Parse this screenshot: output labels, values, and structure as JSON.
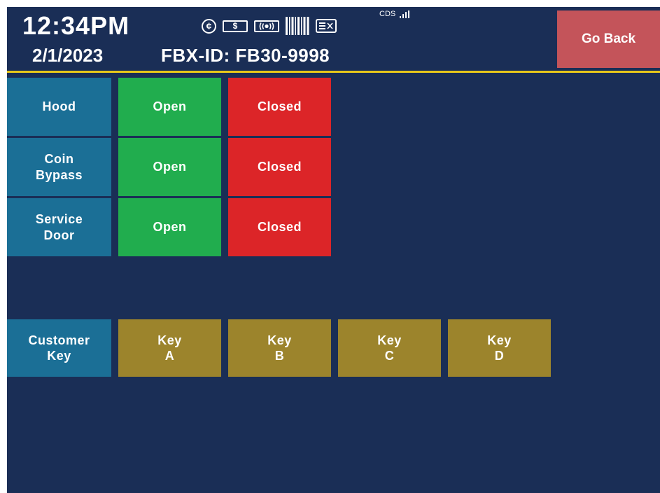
{
  "header": {
    "time": "12:34PM",
    "date": "2/1/2023",
    "fbx_id": "FBX-ID: FB30-9998",
    "icons": [
      "coin-icon",
      "bill-icon",
      "rf-icon",
      "barcode-icon",
      "card-icon"
    ],
    "coin_symbol": "¢",
    "bill_symbol": "$",
    "cds_label": "CDS",
    "go_back_label": "Go Back"
  },
  "colors": {
    "background": "#1a2e56",
    "label_tile": "#1b6f96",
    "open": "#21ad4e",
    "closed": "#dc2528",
    "key": "#9c842c",
    "go_back": "#c4545a",
    "divider": "#e8c81a"
  },
  "rows": [
    {
      "label": "Hood",
      "open": "Open",
      "closed": "Closed"
    },
    {
      "label": "Coin\nBypass",
      "open": "Open",
      "closed": "Closed"
    },
    {
      "label": "Service\nDoor",
      "open": "Open",
      "closed": "Closed"
    }
  ],
  "customer_key": {
    "label": "Customer\nKey",
    "keys": [
      "Key\nA",
      "Key\nB",
      "Key\nC",
      "Key\nD"
    ]
  }
}
